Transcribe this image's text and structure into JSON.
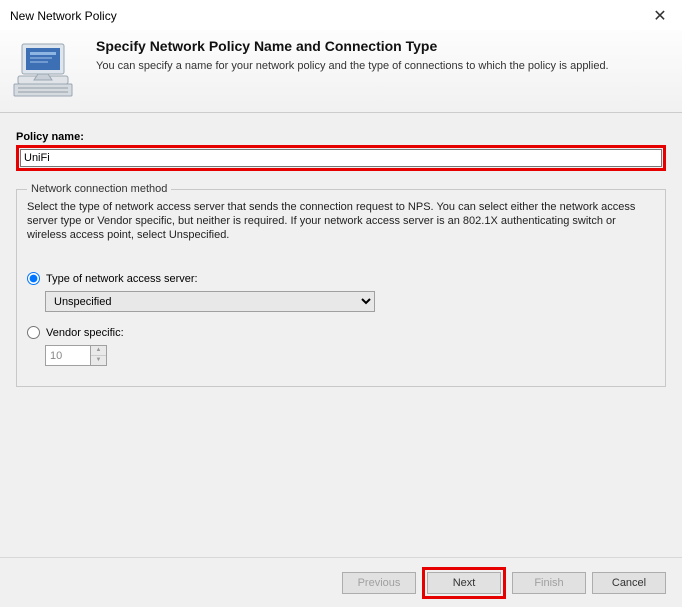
{
  "window": {
    "title": "New Network Policy"
  },
  "header": {
    "heading": "Specify Network Policy Name and Connection Type",
    "sub": "You can specify a name for your network policy and the type of connections to which the policy is applied."
  },
  "policy": {
    "label": "Policy name:",
    "value": "UniFi"
  },
  "group": {
    "legend": "Network connection method",
    "desc": "Select the type of network access server that sends the connection request to NPS. You can select either the network access server type or Vendor specific, but neither is required. If your network access server is an 802.1X authenticating switch or wireless access point, select Unspecified.",
    "radio_type": "Type of network access server:",
    "nas_selected": "Unspecified",
    "radio_vendor": "Vendor specific:",
    "vendor_value": "10"
  },
  "buttons": {
    "previous": "Previous",
    "next": "Next",
    "finish": "Finish",
    "cancel": "Cancel"
  }
}
